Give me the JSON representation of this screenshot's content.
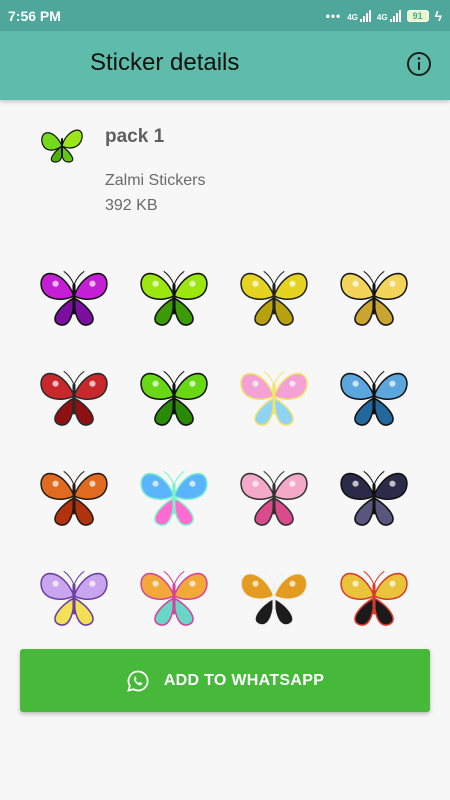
{
  "status_bar": {
    "time": "7:56 PM",
    "signal_labels": [
      "4G",
      "4G"
    ],
    "battery": "91"
  },
  "appbar": {
    "title": "Sticker details",
    "info_icon": "info-icon"
  },
  "pack": {
    "name": "pack 1",
    "author": "Zalmi Stickers",
    "size": "392 KB"
  },
  "stickers": [
    {
      "name": "sticker-magenta-butterfly",
      "colors": [
        "#c51fd6",
        "#7a0fa0",
        "#111111"
      ]
    },
    {
      "name": "sticker-green-butterfly-side",
      "colors": [
        "#9be60f",
        "#3c9a05",
        "#111111"
      ]
    },
    {
      "name": "sticker-yellow-butterfly",
      "colors": [
        "#e6d220",
        "#b8a10e",
        "#222222"
      ]
    },
    {
      "name": "sticker-yellow-black-butterfly",
      "colors": [
        "#f2d45a",
        "#caa430",
        "#151515"
      ]
    },
    {
      "name": "sticker-red-butterfly-swarm",
      "colors": [
        "#c8282c",
        "#8e1013",
        "#2a2a2a"
      ]
    },
    {
      "name": "sticker-green-butterfly",
      "colors": [
        "#69d814",
        "#2a8a06",
        "#111111"
      ]
    },
    {
      "name": "sticker-pastel-rainbow-butterfly",
      "colors": [
        "#f3a1d6",
        "#8fd3f5",
        "#f0e46a"
      ]
    },
    {
      "name": "sticker-blue-butterfly",
      "colors": [
        "#5ba7dd",
        "#21699d",
        "#111111"
      ]
    },
    {
      "name": "sticker-orange-butterfly-side",
      "colors": [
        "#e06b20",
        "#b0320f",
        "#2a1b10"
      ]
    },
    {
      "name": "sticker-rainbow-butterfly",
      "colors": [
        "#5ab4ff",
        "#ff6bd0",
        "#7cf0c8"
      ]
    },
    {
      "name": "sticker-pink-butterfly",
      "colors": [
        "#f5a9c8",
        "#d94b8a",
        "#333333"
      ]
    },
    {
      "name": "sticker-dark-purple-butterfly",
      "colors": [
        "#2b2a48",
        "#59557d",
        "#111111"
      ]
    },
    {
      "name": "sticker-cartoon-butterfly",
      "colors": [
        "#c9a5f0",
        "#f2e056",
        "#6a3fa0"
      ]
    },
    {
      "name": "sticker-colorful-butterfly",
      "colors": [
        "#f3a93a",
        "#6ad6c8",
        "#d4439c"
      ]
    },
    {
      "name": "sticker-monarch-butterfly",
      "colors": [
        "#e39b20",
        "#1c1c1c",
        "#f1f1f1"
      ]
    },
    {
      "name": "sticker-swallowtail-butterfly",
      "colors": [
        "#e9c43a",
        "#1a1a1a",
        "#d73a2a"
      ]
    }
  ],
  "add_button": {
    "label": "ADD TO WHATSAPP",
    "icon": "whatsapp-icon",
    "color": "#46b83a"
  },
  "theme": {
    "status_bar": "#4ea79a",
    "appbar": "#5fbcab"
  }
}
